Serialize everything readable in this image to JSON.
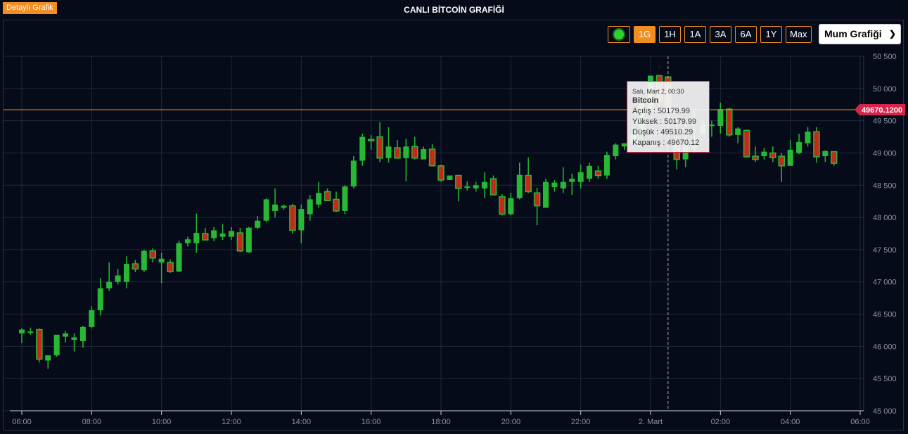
{
  "header": {
    "detail_label": "Detaylı Grafik",
    "title": "CANLI BİTCOİN GRAFİĞİ"
  },
  "toolbar": {
    "live_icon": "live-indicator-icon",
    "ranges": [
      {
        "label": "1G",
        "active": true
      },
      {
        "label": "1H",
        "active": false
      },
      {
        "label": "1A",
        "active": false
      },
      {
        "label": "3A",
        "active": false
      },
      {
        "label": "6A",
        "active": false
      },
      {
        "label": "1Y",
        "active": false
      },
      {
        "label": "Max",
        "active": false
      }
    ],
    "chart_type": "Mum Grafiği",
    "chevron_icon": "chevron-down-icon"
  },
  "tooltip": {
    "time": "Salı, Mart 2, 00:30",
    "name": "Bitcoin",
    "open": "Açılış : 50179.99",
    "high": "Yüksek : 50179.99",
    "low": "Düşük : 49510.29",
    "close": "Kapanış : 49670.12"
  },
  "colors": {
    "background": "#060b19",
    "up": "#27b935",
    "down": "#c6281c",
    "down_border": "#27b935",
    "accent": "#f28d21",
    "price_line": "#f28d21",
    "price_label": "#d6244a",
    "grid": "#1f2a3a",
    "axis_text": "#8a93a3"
  },
  "chart_data": {
    "type": "candlestick",
    "series_name": "Bitcoin",
    "current_price": 49670.12,
    "current_price_label": "49670.1200",
    "ylim": [
      45000,
      50500
    ],
    "y_ticks": [
      {
        "value": 45000,
        "label": "45 000"
      },
      {
        "value": 45500,
        "label": "45 500"
      },
      {
        "value": 46000,
        "label": "46 000"
      },
      {
        "value": 46500,
        "label": "46 500"
      },
      {
        "value": 47000,
        "label": "47 000"
      },
      {
        "value": 47500,
        "label": "47 500"
      },
      {
        "value": 48000,
        "label": "48 000"
      },
      {
        "value": 48500,
        "label": "48 500"
      },
      {
        "value": 49000,
        "label": "49 000"
      },
      {
        "value": 49500,
        "label": "49 500"
      },
      {
        "value": 50000,
        "label": "50 000"
      },
      {
        "value": 50500,
        "label": "50 500"
      }
    ],
    "xlim": [
      0,
      1440
    ],
    "x_ticks": [
      {
        "value": 0,
        "label": "06:00"
      },
      {
        "value": 120,
        "label": "08:00"
      },
      {
        "value": 240,
        "label": "10:00"
      },
      {
        "value": 360,
        "label": "12:00"
      },
      {
        "value": 480,
        "label": "14:00"
      },
      {
        "value": 600,
        "label": "16:00"
      },
      {
        "value": 720,
        "label": "18:00"
      },
      {
        "value": 840,
        "label": "20:00"
      },
      {
        "value": 960,
        "label": "22:00"
      },
      {
        "value": 1080,
        "label": "2. Mart"
      },
      {
        "value": 1200,
        "label": "02:00"
      },
      {
        "value": 1320,
        "label": "04:00"
      },
      {
        "value": 1440,
        "label": "06:00"
      }
    ],
    "crosshair_x": 1110,
    "candles": [
      {
        "t": 0,
        "o": 46200,
        "h": 46280,
        "l": 46050,
        "c": 46260
      },
      {
        "t": 15,
        "o": 46210,
        "h": 46290,
        "l": 46180,
        "c": 46230
      },
      {
        "t": 30,
        "o": 46260,
        "h": 46280,
        "l": 45750,
        "c": 45800
      },
      {
        "t": 45,
        "o": 45780,
        "h": 45850,
        "l": 45650,
        "c": 45860
      },
      {
        "t": 60,
        "o": 45860,
        "h": 46180,
        "l": 45840,
        "c": 46180
      },
      {
        "t": 75,
        "o": 46150,
        "h": 46240,
        "l": 46060,
        "c": 46200
      },
      {
        "t": 90,
        "o": 46100,
        "h": 46200,
        "l": 45920,
        "c": 46140
      },
      {
        "t": 105,
        "o": 46080,
        "h": 46320,
        "l": 45980,
        "c": 46300
      },
      {
        "t": 120,
        "o": 46300,
        "h": 46620,
        "l": 46280,
        "c": 46560
      },
      {
        "t": 135,
        "o": 46560,
        "h": 47060,
        "l": 46480,
        "c": 46900
      },
      {
        "t": 150,
        "o": 46900,
        "h": 47300,
        "l": 46860,
        "c": 47000
      },
      {
        "t": 165,
        "o": 47000,
        "h": 47200,
        "l": 46960,
        "c": 47100
      },
      {
        "t": 180,
        "o": 47000,
        "h": 47400,
        "l": 46900,
        "c": 47280
      },
      {
        "t": 195,
        "o": 47280,
        "h": 47340,
        "l": 47150,
        "c": 47200
      },
      {
        "t": 210,
        "o": 47180,
        "h": 47500,
        "l": 47150,
        "c": 47480
      },
      {
        "t": 225,
        "o": 47480,
        "h": 47520,
        "l": 47300,
        "c": 47370
      },
      {
        "t": 240,
        "o": 47300,
        "h": 47450,
        "l": 46980,
        "c": 47360
      },
      {
        "t": 255,
        "o": 47300,
        "h": 47350,
        "l": 47140,
        "c": 47160
      },
      {
        "t": 270,
        "o": 47160,
        "h": 47640,
        "l": 47150,
        "c": 47600
      },
      {
        "t": 285,
        "o": 47600,
        "h": 47700,
        "l": 47550,
        "c": 47660
      },
      {
        "t": 300,
        "o": 47600,
        "h": 48060,
        "l": 47450,
        "c": 47760
      },
      {
        "t": 315,
        "o": 47750,
        "h": 47840,
        "l": 47680,
        "c": 47650
      },
      {
        "t": 330,
        "o": 47680,
        "h": 47850,
        "l": 47630,
        "c": 47800
      },
      {
        "t": 345,
        "o": 47700,
        "h": 47900,
        "l": 47650,
        "c": 47750
      },
      {
        "t": 360,
        "o": 47700,
        "h": 47850,
        "l": 47650,
        "c": 47790
      },
      {
        "t": 375,
        "o": 47760,
        "h": 47840,
        "l": 47460,
        "c": 47480
      },
      {
        "t": 390,
        "o": 47460,
        "h": 47850,
        "l": 47450,
        "c": 47840
      },
      {
        "t": 405,
        "o": 47840,
        "h": 48020,
        "l": 47820,
        "c": 47950
      },
      {
        "t": 420,
        "o": 47950,
        "h": 48300,
        "l": 47930,
        "c": 48280
      },
      {
        "t": 435,
        "o": 48100,
        "h": 48450,
        "l": 48000,
        "c": 48200
      },
      {
        "t": 450,
        "o": 48150,
        "h": 48200,
        "l": 48120,
        "c": 48180
      },
      {
        "t": 465,
        "o": 48180,
        "h": 48210,
        "l": 47750,
        "c": 47800
      },
      {
        "t": 480,
        "o": 47800,
        "h": 48200,
        "l": 47600,
        "c": 48130
      },
      {
        "t": 495,
        "o": 48050,
        "h": 48350,
        "l": 47950,
        "c": 48280
      },
      {
        "t": 510,
        "o": 48200,
        "h": 48550,
        "l": 48150,
        "c": 48380
      },
      {
        "t": 525,
        "o": 48400,
        "h": 48450,
        "l": 48250,
        "c": 48260
      },
      {
        "t": 540,
        "o": 48280,
        "h": 48400,
        "l": 48080,
        "c": 48100
      },
      {
        "t": 555,
        "o": 48100,
        "h": 48500,
        "l": 48050,
        "c": 48480
      },
      {
        "t": 570,
        "o": 48480,
        "h": 48950,
        "l": 48450,
        "c": 48880
      },
      {
        "t": 585,
        "o": 48880,
        "h": 49300,
        "l": 48800,
        "c": 49250
      },
      {
        "t": 600,
        "o": 49210,
        "h": 49280,
        "l": 49050,
        "c": 49200
      },
      {
        "t": 615,
        "o": 49250,
        "h": 49480,
        "l": 48860,
        "c": 48920
      },
      {
        "t": 630,
        "o": 48920,
        "h": 49400,
        "l": 48850,
        "c": 49100
      },
      {
        "t": 645,
        "o": 49080,
        "h": 49200,
        "l": 48910,
        "c": 48920
      },
      {
        "t": 660,
        "o": 48920,
        "h": 49220,
        "l": 48560,
        "c": 49100
      },
      {
        "t": 675,
        "o": 49100,
        "h": 49250,
        "l": 48900,
        "c": 48920
      },
      {
        "t": 690,
        "o": 48900,
        "h": 49100,
        "l": 48900,
        "c": 49060
      },
      {
        "t": 705,
        "o": 49060,
        "h": 49140,
        "l": 48790,
        "c": 48800
      },
      {
        "t": 720,
        "o": 48800,
        "h": 48820,
        "l": 48550,
        "c": 48580
      },
      {
        "t": 735,
        "o": 48580,
        "h": 48650,
        "l": 48580,
        "c": 48650
      },
      {
        "t": 750,
        "o": 48650,
        "h": 48660,
        "l": 48250,
        "c": 48450
      },
      {
        "t": 765,
        "o": 48460,
        "h": 48560,
        "l": 48420,
        "c": 48480
      },
      {
        "t": 780,
        "o": 48450,
        "h": 48550,
        "l": 48400,
        "c": 48500
      },
      {
        "t": 795,
        "o": 48450,
        "h": 48700,
        "l": 48300,
        "c": 48550
      },
      {
        "t": 810,
        "o": 48600,
        "h": 48650,
        "l": 48350,
        "c": 48350
      },
      {
        "t": 825,
        "o": 48320,
        "h": 48360,
        "l": 48030,
        "c": 48050
      },
      {
        "t": 840,
        "o": 48050,
        "h": 48380,
        "l": 48030,
        "c": 48300
      },
      {
        "t": 855,
        "o": 48300,
        "h": 48850,
        "l": 48280,
        "c": 48660
      },
      {
        "t": 870,
        "o": 48650,
        "h": 48930,
        "l": 48380,
        "c": 48400
      },
      {
        "t": 885,
        "o": 48380,
        "h": 48460,
        "l": 47880,
        "c": 48180
      },
      {
        "t": 900,
        "o": 48150,
        "h": 48600,
        "l": 48150,
        "c": 48550
      },
      {
        "t": 915,
        "o": 48470,
        "h": 48580,
        "l": 48400,
        "c": 48540
      },
      {
        "t": 930,
        "o": 48450,
        "h": 48780,
        "l": 48380,
        "c": 48550
      },
      {
        "t": 945,
        "o": 48550,
        "h": 48680,
        "l": 48350,
        "c": 48600
      },
      {
        "t": 960,
        "o": 48550,
        "h": 48820,
        "l": 48450,
        "c": 48700
      },
      {
        "t": 975,
        "o": 48600,
        "h": 48850,
        "l": 48550,
        "c": 48800
      },
      {
        "t": 990,
        "o": 48720,
        "h": 48800,
        "l": 48600,
        "c": 48650
      },
      {
        "t": 1005,
        "o": 48650,
        "h": 49020,
        "l": 48600,
        "c": 48970
      },
      {
        "t": 1020,
        "o": 48950,
        "h": 49150,
        "l": 48900,
        "c": 49130
      },
      {
        "t": 1035,
        "o": 49100,
        "h": 49150,
        "l": 49050,
        "c": 49150
      },
      {
        "t": 1050,
        "o": 49150,
        "h": 49400,
        "l": 49120,
        "c": 49300
      },
      {
        "t": 1065,
        "o": 49300,
        "h": 49850,
        "l": 49100,
        "c": 49760
      },
      {
        "t": 1080,
        "o": 49700,
        "h": 50200,
        "l": 49650,
        "c": 50200
      },
      {
        "t": 1095,
        "o": 50200,
        "h": 50200,
        "l": 49700,
        "c": 49800
      },
      {
        "t": 1110,
        "o": 50179.99,
        "h": 50179.99,
        "l": 49510.29,
        "c": 49670.12
      },
      {
        "t": 1125,
        "o": 49200,
        "h": 49650,
        "l": 48750,
        "c": 48900
      },
      {
        "t": 1140,
        "o": 48900,
        "h": 49500,
        "l": 48780,
        "c": 49100
      },
      {
        "t": 1155,
        "o": 49100,
        "h": 49650,
        "l": 49000,
        "c": 49100
      },
      {
        "t": 1170,
        "o": 49300,
        "h": 49500,
        "l": 49300,
        "c": 49440
      },
      {
        "t": 1185,
        "o": 49420,
        "h": 49500,
        "l": 49250,
        "c": 49440
      },
      {
        "t": 1200,
        "o": 49420,
        "h": 49780,
        "l": 49300,
        "c": 49680
      },
      {
        "t": 1215,
        "o": 49680,
        "h": 49700,
        "l": 49250,
        "c": 49280
      },
      {
        "t": 1230,
        "o": 49280,
        "h": 49400,
        "l": 49150,
        "c": 49380
      },
      {
        "t": 1245,
        "o": 49350,
        "h": 49360,
        "l": 48930,
        "c": 48940
      },
      {
        "t": 1260,
        "o": 48950,
        "h": 49100,
        "l": 48860,
        "c": 48900
      },
      {
        "t": 1275,
        "o": 48950,
        "h": 49080,
        "l": 48900,
        "c": 49020
      },
      {
        "t": 1290,
        "o": 49000,
        "h": 49100,
        "l": 48860,
        "c": 48930
      },
      {
        "t": 1305,
        "o": 48950,
        "h": 49000,
        "l": 48550,
        "c": 48800
      },
      {
        "t": 1320,
        "o": 48800,
        "h": 49200,
        "l": 48800,
        "c": 49050
      },
      {
        "t": 1335,
        "o": 49000,
        "h": 49300,
        "l": 48980,
        "c": 49170
      },
      {
        "t": 1350,
        "o": 49150,
        "h": 49400,
        "l": 49100,
        "c": 49330
      },
      {
        "t": 1365,
        "o": 49330,
        "h": 49400,
        "l": 48850,
        "c": 48940
      },
      {
        "t": 1380,
        "o": 48950,
        "h": 49040,
        "l": 48860,
        "c": 49030
      },
      {
        "t": 1395,
        "o": 49020,
        "h": 49020,
        "l": 48800,
        "c": 48840
      }
    ]
  }
}
